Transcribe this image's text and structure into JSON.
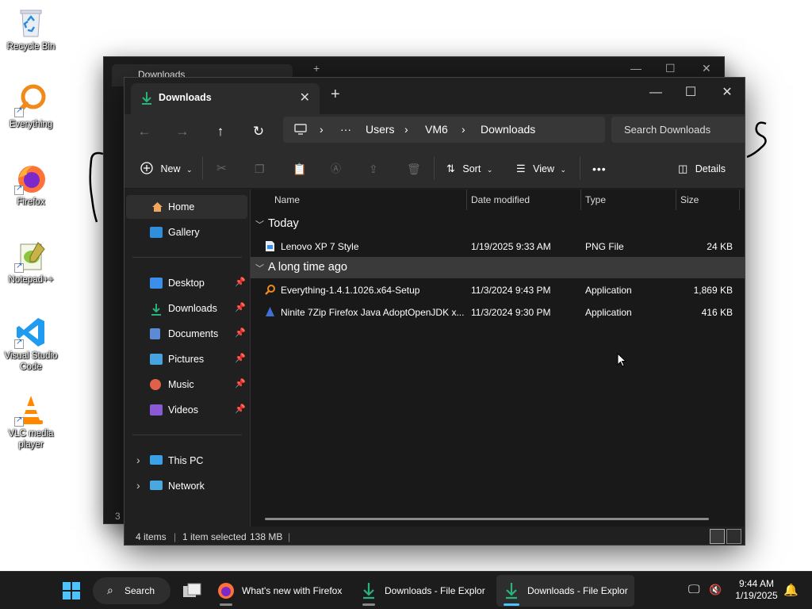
{
  "desktop": {
    "icons": [
      {
        "label": "Recycle Bin",
        "icon": "recycle-bin-icon"
      },
      {
        "label": "Everything",
        "icon": "everything-icon"
      },
      {
        "label": "Firefox",
        "icon": "firefox-icon"
      },
      {
        "label": "Notepad++",
        "icon": "notepad-plus-plus-icon"
      },
      {
        "label": "Visual Studio Code",
        "icon": "vscode-icon"
      },
      {
        "label": "VLC media player",
        "icon": "vlc-icon"
      }
    ]
  },
  "background_window": {
    "tab_title": "Downloads",
    "new_tab": "+",
    "status_fragment": "3"
  },
  "window": {
    "tab_title": "Downloads",
    "tab_close": "✕",
    "new_tab": "+",
    "controls": {
      "minimize": "—",
      "maximize": "☐",
      "close": "✕"
    },
    "nav": {
      "back": "←",
      "forward": "→",
      "up": "↑",
      "refresh": "↻"
    },
    "breadcrumb": [
      "Users",
      "VM6",
      "Downloads"
    ],
    "breadcrumb_more": "···",
    "search_placeholder": "Search Downloads",
    "toolbar": {
      "new": "New",
      "sort": "Sort",
      "view": "View",
      "more": "•••",
      "details": "Details"
    },
    "sidebar": {
      "top": [
        {
          "label": "Home",
          "icon": "home-icon",
          "selected": true
        },
        {
          "label": "Gallery",
          "icon": "gallery-icon"
        }
      ],
      "pinned": [
        {
          "label": "Desktop",
          "icon": "desktop-folder-icon",
          "color": "#3b8eea"
        },
        {
          "label": "Downloads",
          "icon": "downloads-folder-icon",
          "color": "#27b37a"
        },
        {
          "label": "Documents",
          "icon": "documents-folder-icon",
          "color": "#5b8bd6"
        },
        {
          "label": "Pictures",
          "icon": "pictures-folder-icon",
          "color": "#46a2e0"
        },
        {
          "label": "Music",
          "icon": "music-folder-icon",
          "color": "#e0604a"
        },
        {
          "label": "Videos",
          "icon": "videos-folder-icon",
          "color": "#8a5ad6"
        }
      ],
      "bottom": [
        {
          "label": "This PC",
          "icon": "this-pc-icon"
        },
        {
          "label": "Network",
          "icon": "network-icon"
        }
      ]
    },
    "columns": [
      "Name",
      "Date modified",
      "Type",
      "Size"
    ],
    "groups": [
      {
        "label": "Today",
        "selected": false,
        "files": [
          {
            "name": "Lenovo XP 7 Style",
            "date": "1/19/2025 9:33 AM",
            "type": "PNG File",
            "size": "24 KB",
            "icon": "png-file-icon"
          }
        ]
      },
      {
        "label": "A long time ago",
        "selected": true,
        "files": [
          {
            "name": "Everything-1.4.1.1026.x64-Setup",
            "date": "11/3/2024 9:43 PM",
            "type": "Application",
            "size": "1,869 KB",
            "icon": "everything-setup-icon"
          },
          {
            "name": "Ninite 7Zip Firefox Java AdoptOpenJDK x...",
            "date": "11/3/2024 9:30 PM",
            "type": "Application",
            "size": "416 KB",
            "icon": "ninite-icon"
          }
        ]
      }
    ],
    "status": {
      "items": "4 items",
      "selected": "1 item selected",
      "size": "138 MB",
      "sep": "|"
    }
  },
  "taskbar": {
    "search_label": "Search",
    "apps": [
      {
        "label": "What's new with Firefox",
        "icon": "firefox-icon",
        "active": false
      },
      {
        "label": "Downloads - File Explor",
        "icon": "file-explorer-icon",
        "active": false
      },
      {
        "label": "Downloads - File Explor",
        "icon": "file-explorer-icon",
        "active": true
      }
    ],
    "clock": {
      "time": "9:44 AM",
      "date": "1/19/2025"
    }
  }
}
